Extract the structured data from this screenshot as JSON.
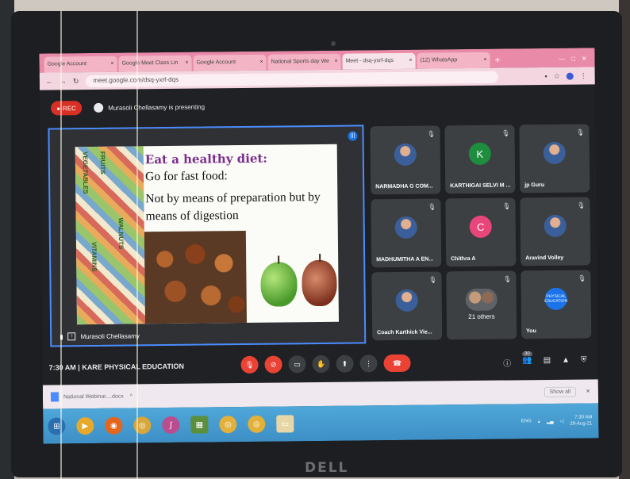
{
  "browser": {
    "tabs": [
      {
        "label": "Google Account",
        "active": false
      },
      {
        "label": "Google Meet Class Lin",
        "active": false
      },
      {
        "label": "Google Account",
        "active": false
      },
      {
        "label": "National Sports day We",
        "active": false
      },
      {
        "label": "Meet - dsq-yxrf-dqs",
        "active": true
      },
      {
        "label": "(12) WhatsApp",
        "active": false
      }
    ],
    "close_glyph": "×",
    "new_tab": "+",
    "url": "meet.google.com/dsq-yxrf-dqs"
  },
  "meet": {
    "rec_label": "REC",
    "presenting_text": "Murasoli Chellasamy is presenting",
    "presenter_tile_name": "Murasoli Chellasamy",
    "slide": {
      "title": "Eat a healthy diet:",
      "line1": "Go for fast food:",
      "line2": "Not by means of preparation but by",
      "line3": "means of digestion",
      "collage_words": [
        "VEGETABLES",
        "FRUITS",
        "WALNUTS",
        "VITAMINS"
      ]
    },
    "participants": [
      {
        "name": "NARMADHA G COM...",
        "avatar": "photo",
        "letter": ""
      },
      {
        "name": "KARTHIGAI SELVI M ...",
        "avatar": "letter",
        "letter": "K",
        "color": "#1e8e3e"
      },
      {
        "name": "jp Guru",
        "avatar": "photo",
        "letter": ""
      },
      {
        "name": "MADHUMITHA A EN...",
        "avatar": "photo",
        "letter": ""
      },
      {
        "name": "Chithra A",
        "avatar": "letter",
        "letter": "C",
        "color": "#e8457a"
      },
      {
        "name": "Aravind Volley",
        "avatar": "photo",
        "letter": ""
      },
      {
        "name": "Coach Karthick Vie...",
        "avatar": "photo",
        "letter": ""
      },
      {
        "name": "",
        "avatar": "group",
        "letter": "",
        "others_label": "21 others"
      },
      {
        "name": "You",
        "avatar": "you",
        "letter": "",
        "you_text": "PHYSICAL EDUCATION"
      }
    ],
    "meeting_info": "7:30 AM  |  KARE PHYSICAL EDUCATION",
    "people_count": "30",
    "accent_blue": "#1a73e8",
    "danger_red": "#ea4335"
  },
  "downloads": {
    "file": "National Webinar....docx",
    "show_all": "Show all"
  },
  "taskbar": {
    "lang": "ENG",
    "time": "7:30 AM",
    "date": "29-Aug-21"
  },
  "device": {
    "brand": "DELL"
  }
}
